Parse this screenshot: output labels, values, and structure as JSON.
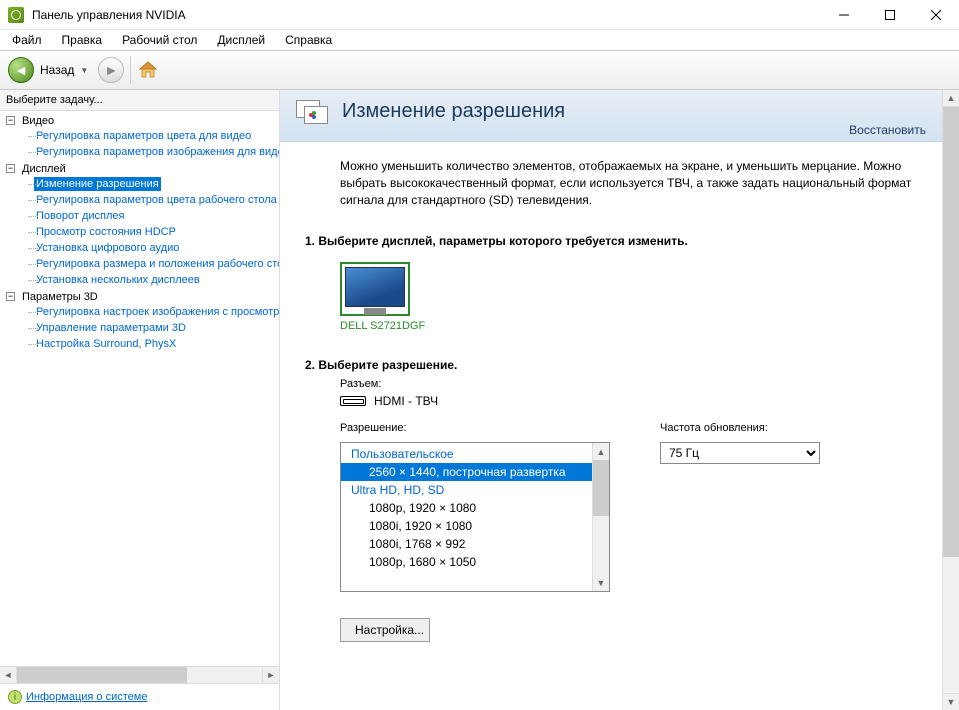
{
  "window": {
    "title": "Панель управления NVIDIA"
  },
  "menu": {
    "file": "Файл",
    "edit": "Правка",
    "desktop": "Рабочий стол",
    "display": "Дисплей",
    "help": "Справка"
  },
  "toolbar": {
    "back": "Назад"
  },
  "leftpanel": {
    "header": "Выберите задачу...",
    "tree": {
      "video": {
        "label": "Видео",
        "items": [
          "Регулировка параметров цвета для видео",
          "Регулировка параметров изображения для видео"
        ]
      },
      "display": {
        "label": "Дисплей",
        "items": [
          "Изменение разрешения",
          "Регулировка параметров цвета рабочего стола",
          "Поворот дисплея",
          "Просмотр состояния HDCP",
          "Установка цифрового аудио",
          "Регулировка размера и положения рабочего стола",
          "Установка нескольких дисплеев"
        ]
      },
      "params3d": {
        "label": "Параметры 3D",
        "items": [
          "Регулировка настроек изображения с просмотром",
          "Управление параметрами 3D",
          "Настройка Surround, PhysX"
        ]
      }
    },
    "sysinfo": "Информация о системе"
  },
  "rightpanel": {
    "title": "Изменение разрешения",
    "restore": "Восстановить",
    "description": "Можно уменьшить количество элементов, отображаемых на экране, и уменьшить мерцание. Можно выбрать высококачественный формат, если используется ТВЧ, а также задать национальный формат сигнала для стандартного (SD) телевидения.",
    "section1": "1. Выберите дисплей, параметры которого требуется изменить.",
    "display_name": "DELL S2721DGF",
    "section2": "2. Выберите разрешение.",
    "connector_label": "Разъем:",
    "connector_value": "HDMI - ТВЧ",
    "resolution_label": "Разрешение:",
    "refresh_label": "Частота обновления:",
    "refresh_value": "75 Гц",
    "res_list": {
      "cat1": "Пользовательское",
      "item_selected": "2560 × 1440, построчная развертка",
      "cat2": "Ultra HD, HD, SD",
      "items": [
        "1080p, 1920 × 1080",
        "1080i, 1920 × 1080",
        "1080i, 1768 × 992",
        "1080p, 1680 × 1050"
      ]
    },
    "configure_btn": "Настройка..."
  }
}
